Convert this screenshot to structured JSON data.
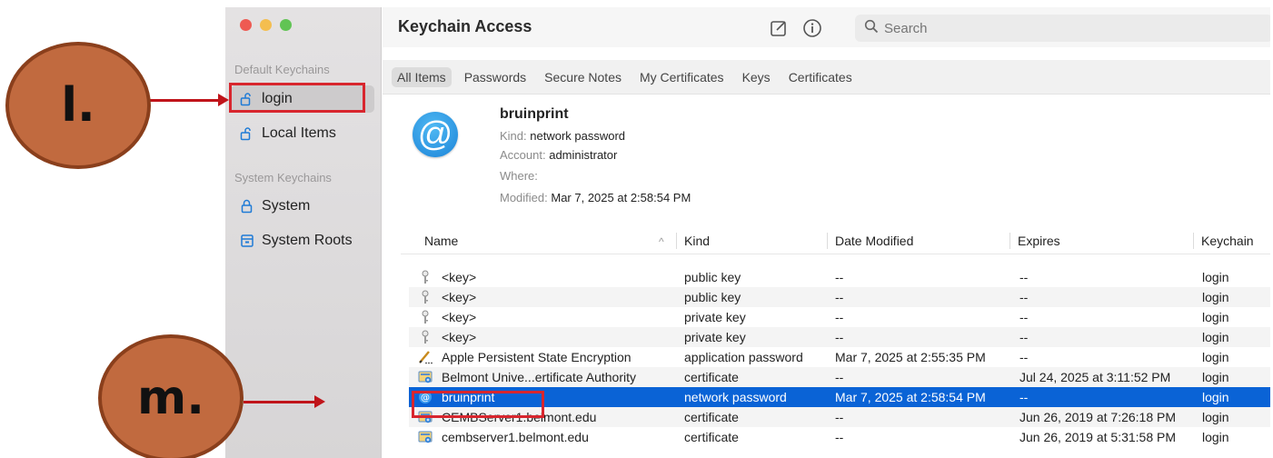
{
  "callouts": {
    "l": "l.",
    "m": "m."
  },
  "window": {
    "title": "Keychain Access",
    "search_placeholder": "Search"
  },
  "sidebar": {
    "default_section": "Default Keychains",
    "system_section": "System Keychains",
    "items": [
      {
        "label": "login",
        "icon": "unlocked-padlock-icon",
        "active": true
      },
      {
        "label": "Local Items",
        "icon": "unlocked-padlock-icon",
        "active": false
      },
      {
        "label": "System",
        "icon": "locked-padlock-icon",
        "active": false
      },
      {
        "label": "System Roots",
        "icon": "cabinet-icon",
        "active": false
      }
    ]
  },
  "tabs": [
    "All Items",
    "Passwords",
    "Secure Notes",
    "My Certificates",
    "Keys",
    "Certificates"
  ],
  "detail": {
    "name": "bruinprint",
    "kind_label": "Kind:",
    "kind": "network password",
    "account_label": "Account:",
    "account": "administrator",
    "where_label": "Where:",
    "where": "",
    "modified_label": "Modified:",
    "modified": "Mar 7, 2025 at 2:58:54 PM"
  },
  "table": {
    "columns": [
      "Name",
      "Kind",
      "Date Modified",
      "Expires",
      "Keychain"
    ],
    "sort_indicator": "^",
    "rows": [
      {
        "icon": "key-icon",
        "name": "<key>",
        "kind": "public key",
        "modified": "--",
        "expires": "--",
        "keychain": "login"
      },
      {
        "icon": "key-icon",
        "name": "<key>",
        "kind": "public key",
        "modified": "--",
        "expires": "--",
        "keychain": "login"
      },
      {
        "icon": "key-icon",
        "name": "<key>",
        "kind": "private key",
        "modified": "--",
        "expires": "--",
        "keychain": "login"
      },
      {
        "icon": "key-icon",
        "name": "<key>",
        "kind": "private key",
        "modified": "--",
        "expires": "--",
        "keychain": "login"
      },
      {
        "icon": "pen-icon",
        "name": "Apple Persistent State Encryption",
        "kind": "application password",
        "modified": "Mar 7, 2025 at 2:55:35 PM",
        "expires": "--",
        "keychain": "login"
      },
      {
        "icon": "certificate-icon",
        "name": "Belmont Unive...ertificate Authority",
        "kind": "certificate",
        "modified": "--",
        "expires": "Jul 24, 2025 at 3:11:52 PM",
        "keychain": "login"
      },
      {
        "icon": "at-sign-icon",
        "name": "bruinprint",
        "kind": "network password",
        "modified": "Mar 7, 2025 at 2:58:54 PM",
        "expires": "--",
        "keychain": "login",
        "selected": true
      },
      {
        "icon": "certificate-icon",
        "name": "CEMBServer1.belmont.edu",
        "kind": "certificate",
        "modified": "--",
        "expires": "Jun 26, 2019 at 7:26:18 PM",
        "keychain": "login"
      },
      {
        "icon": "certificate-icon",
        "name": "cembserver1.belmont.edu",
        "kind": "certificate",
        "modified": "--",
        "expires": "Jun 26, 2019 at 5:31:58 PM",
        "keychain": "login"
      }
    ]
  }
}
